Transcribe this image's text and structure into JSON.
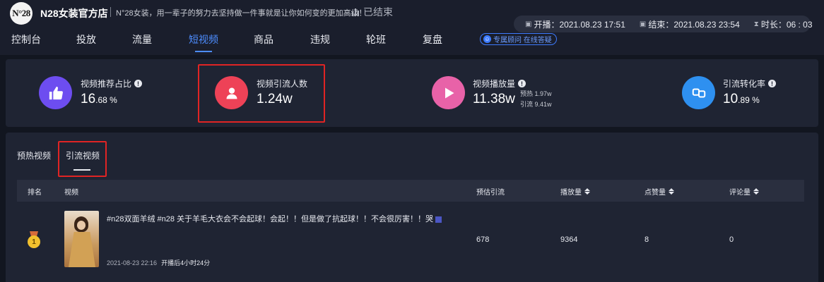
{
  "header": {
    "logo_text": "N°28",
    "shop_name": "N28女装官方店",
    "slogan": "N°28女装，用一辈子的努力去坚持做一件事就是让你如何变的更加高级！",
    "status": "已结束",
    "time_info": {
      "start": "开播：2021.08.23 17:51",
      "end": "结束：2021.08.23 23:54",
      "duration": "时长：06 : 03"
    },
    "advisor_label": "专属顾问 在线答疑"
  },
  "nav": {
    "items": [
      {
        "label": "控制台"
      },
      {
        "label": "投放"
      },
      {
        "label": "流量"
      },
      {
        "label": "短视频"
      },
      {
        "label": "商品"
      },
      {
        "label": "违规"
      },
      {
        "label": "轮班"
      },
      {
        "label": "复盘"
      }
    ],
    "active_index": 3
  },
  "stats": [
    {
      "label": "视频推荐占比",
      "value_main": "16",
      "value_small": ".68 %",
      "icon": "thumbs-up-icon",
      "color": "#6d4df0"
    },
    {
      "label": "视频引流人数",
      "value_main": "1.24w",
      "value_small": "",
      "icon": "user-icon",
      "color": "#ee4257"
    },
    {
      "label": "视频播放量",
      "value_main": "11.38w",
      "value_small": "",
      "icon": "play-icon",
      "color": "#e862a8",
      "sub": [
        {
          "text": "预热 1.97w"
        },
        {
          "text": "引流 9.41w"
        }
      ]
    },
    {
      "label": "引流转化率",
      "value_main": "10",
      "value_small": ".89 %",
      "icon": "convert-icon",
      "color": "#2e90f0"
    }
  ],
  "video_tabs": [
    {
      "label": "预热视频"
    },
    {
      "label": "引流视频"
    }
  ],
  "video_tabs_active_index": 1,
  "table": {
    "headers": {
      "rank": "排名",
      "video": "视频",
      "est_traffic": "预估引流",
      "plays": "播放量",
      "likes": "点赞量",
      "comments": "评论量"
    },
    "rows": [
      {
        "rank": "1",
        "title": "#n28双面羊绒 #n28 关于羊毛大衣会不会起球！会起！！但是做了抗起球！！不会很厉害！！哭",
        "date": "2021-08-23 22:16",
        "after": "开播后4小时24分",
        "est_traffic": "678",
        "plays": "9364",
        "likes": "8",
        "comments": "0"
      }
    ]
  }
}
